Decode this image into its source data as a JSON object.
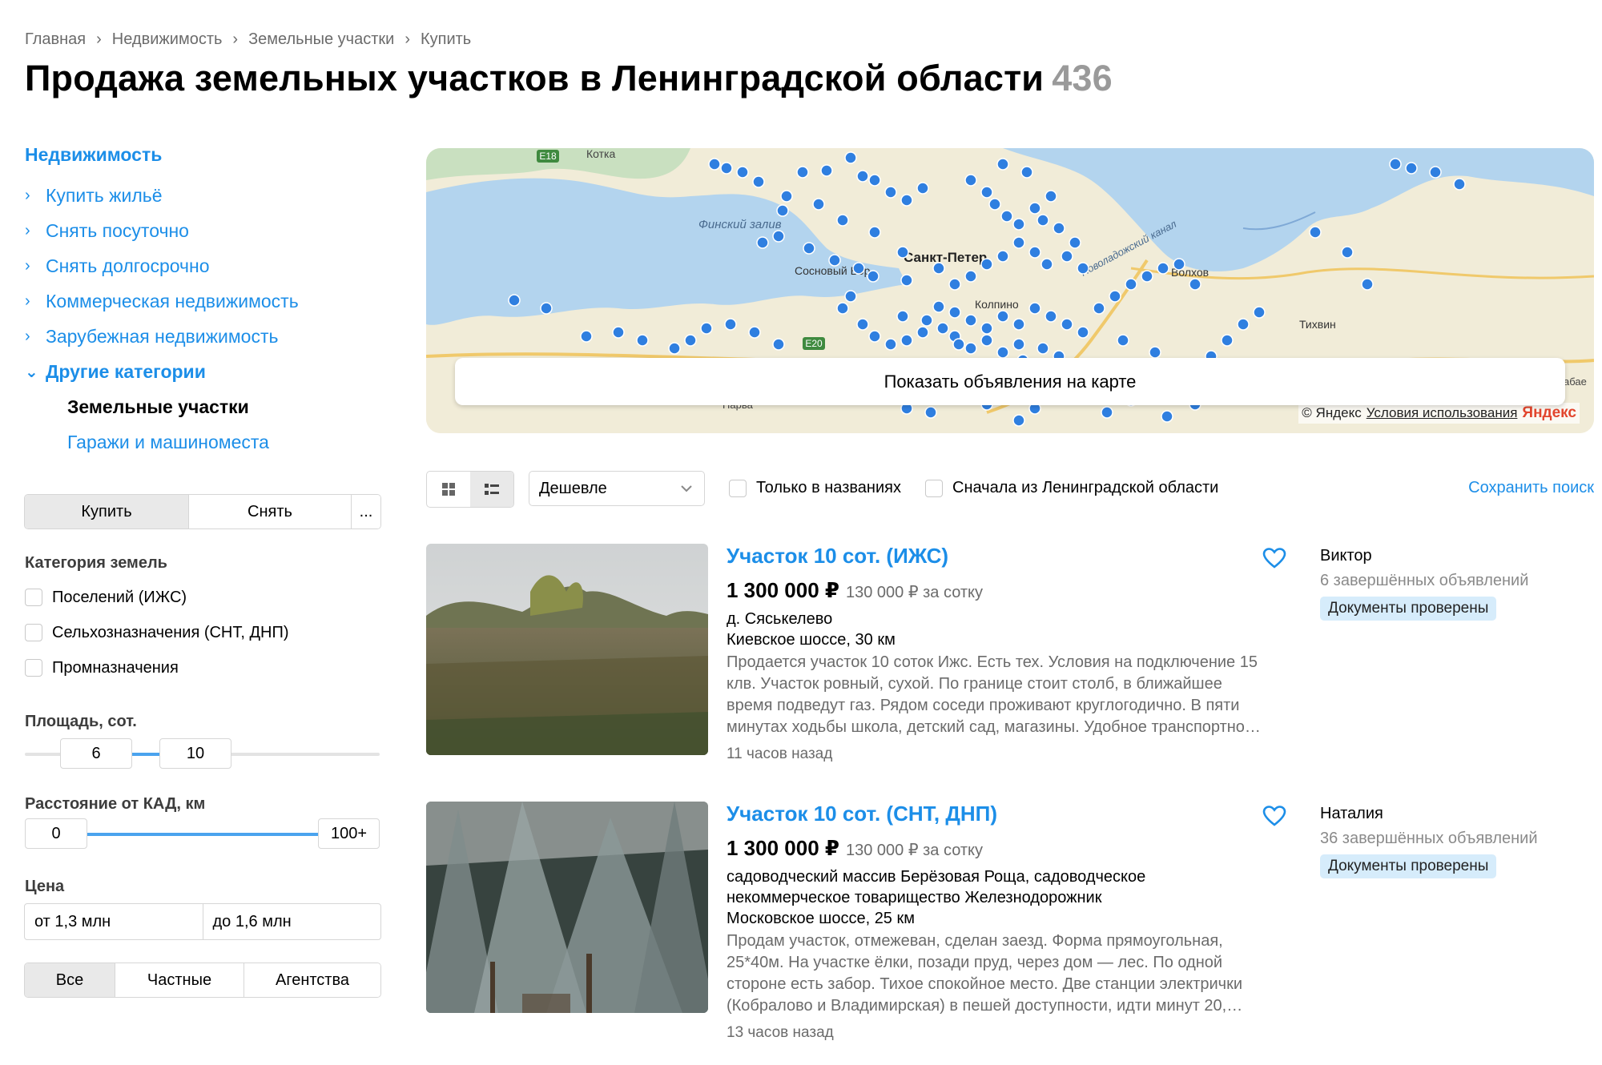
{
  "breadcrumb": [
    "Главная",
    "Недвижимость",
    "Земельные участки",
    "Купить"
  ],
  "header": {
    "title": "Продажа земельных участков в Ленинградской области",
    "count": "436"
  },
  "nav": {
    "heading": "Недвижимость",
    "items": [
      {
        "label": "Купить жильё"
      },
      {
        "label": "Снять посуточно"
      },
      {
        "label": "Снять долгосрочно"
      },
      {
        "label": "Коммерческая недвижимость"
      },
      {
        "label": "Зарубежная недвижимость"
      },
      {
        "label": "Другие категории"
      }
    ],
    "sub": [
      {
        "label": "Земельные участки"
      },
      {
        "label": "Гаражи и машиноместа"
      }
    ]
  },
  "deal": {
    "buy": "Купить",
    "rent": "Снять",
    "more": "..."
  },
  "land_category": {
    "label": "Категория земель",
    "options": [
      "Поселений (ИЖС)",
      "Сельхозназначения (СНТ, ДНП)",
      "Промназначения"
    ]
  },
  "area": {
    "label": "Площадь, сот.",
    "from": "6",
    "to": "10"
  },
  "distance": {
    "label": "Расстояние от КАД, км",
    "from": "0",
    "to": "100+"
  },
  "price": {
    "label": "Цена",
    "from": "от 1,3 млн",
    "to": "до 1,6 млн"
  },
  "seller_type": {
    "all": "Все",
    "private": "Частные",
    "agency": "Агентства"
  },
  "map": {
    "button": "Показать объявления на карте",
    "labels": {
      "gulf": "Финский залив",
      "spb": "Санкт-Петер",
      "sosnovy": "Сосновый Бор",
      "kolpino": "Колпино",
      "kotka": "Котка",
      "volkhov": "Волхов",
      "tikhvin": "Тихвин",
      "canal": "Новоладожский канал",
      "narva": "Нарва",
      "e18": "E18",
      "e20": "E20",
      "edge": "абае"
    },
    "attribution": {
      "copy": "© Яндекс",
      "terms": "Условия использования",
      "logo": "Яндекс"
    }
  },
  "toolbar": {
    "sort": "Дешевле",
    "only_titles": "Только в названиях",
    "first_region": "Сначала из Ленинградской области",
    "save_search": "Сохранить поиск"
  },
  "listings": [
    {
      "title": "Участок 10 сот. (ИЖС)",
      "price": "1 300 000 ₽",
      "price_per_unit": "130 000 ₽ за сотку",
      "address": [
        "д. Сяськелево",
        "Киевское шоссе, 30 км"
      ],
      "description": [
        "Продается участок 10 соток Ижс. Есть тех. Условия на подключение 15",
        "клв. Участок ровный, сухой. По границе стоит столб, в ближайшее",
        "время подведут газ. Рядом соседи проживают круглогодично. В пяти",
        "минутах ходьбы школа, детский сад, магазины. Удобное транспортно…"
      ],
      "time": "11 часов назад",
      "seller": "Виктор",
      "seller_stats": "6 завершённых объявлений",
      "badge": "Документы проверены"
    },
    {
      "title": "Участок 10 сот. (СНТ, ДНП)",
      "price": "1 300 000 ₽",
      "price_per_unit": "130 000 ₽ за сотку",
      "address": [
        "садоводческий массив Берёзовая Роща, садоводческое",
        "некоммерческое товарищество Железнодорожник",
        "Московское шоссе, 25 км"
      ],
      "description": [
        "Продам участок, отмежеван, сделан заезд. Форма прямоугольная,",
        "25*40м. На участке ёлки, позади пруд, через дом — лес. По одной",
        "стороне есть забор. Тихое спокойное место. Две станции электрички",
        "(Кобралово и Владимирская) в пешей доступности, идти минут 20,…"
      ],
      "time": "13 часов назад",
      "seller": "Наталия",
      "seller_stats": "36 завершённых объявлений",
      "badge": "Документы проверены"
    }
  ],
  "colors": {
    "accent": "#1c8ee8",
    "badge_bg": "#d6ecfb",
    "map_dot": "#2f7fe0",
    "water": "#b3d4ee",
    "land": "#f1ecd8"
  }
}
